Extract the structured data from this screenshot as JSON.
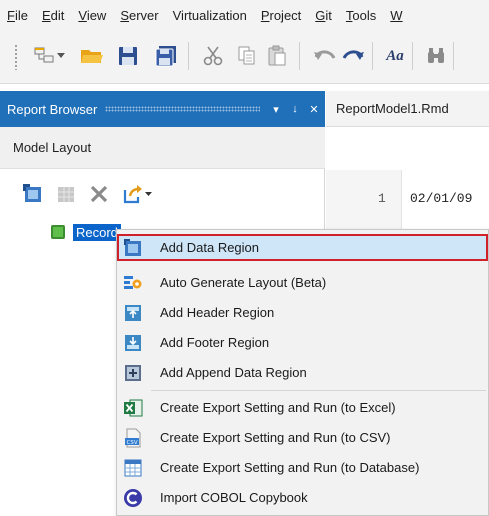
{
  "menubar": {
    "items": [
      {
        "u": "F",
        "rest": "ile"
      },
      {
        "u": "E",
        "rest": "dit"
      },
      {
        "u": "V",
        "rest": "iew"
      },
      {
        "u": "S",
        "rest": "erver"
      },
      {
        "u": "",
        "rest": "Virtualization"
      },
      {
        "u": "P",
        "rest": "roject"
      },
      {
        "u": "G",
        "rest": "it"
      },
      {
        "u": "T",
        "rest": "ools"
      },
      {
        "u": "W",
        "rest": ""
      }
    ]
  },
  "toolbar": {
    "icons": [
      "grip-icon",
      "new-item-icon",
      "open-folder-icon",
      "save-icon",
      "save-all-icon",
      "cut-icon",
      "copy-icon",
      "paste-icon",
      "undo-icon",
      "redo-icon",
      "font-icon",
      "find-icon"
    ],
    "font_label": "Aa"
  },
  "report_browser": {
    "title": "Report Browser",
    "pin_glyph": "↓",
    "close_glyph": "✕",
    "dropdown_glyph": "▾",
    "tab_label": "Model Layout",
    "tree": {
      "record_label": "Record"
    }
  },
  "editor": {
    "tab_label": "ReportModel1.Rmd",
    "line_number": "1",
    "line_text": "02/01/09"
  },
  "context_menu": {
    "items": [
      {
        "label": "Add Data Region",
        "icon": "data-region-icon",
        "highlighted": true
      },
      {
        "label": "Auto Generate Layout (Beta)",
        "icon": "auto-generate-icon"
      },
      {
        "label": "Add Header Region",
        "icon": "header-region-icon"
      },
      {
        "label": "Add Footer Region",
        "icon": "footer-region-icon"
      },
      {
        "label": "Add Append Data Region",
        "icon": "append-region-icon"
      },
      {
        "label": "Create Export Setting and Run (to Excel)",
        "icon": "excel-icon"
      },
      {
        "label": "Create Export Setting and Run (to CSV)",
        "icon": "csv-icon"
      },
      {
        "label": "Create Export Setting and Run (to Database)",
        "icon": "database-table-icon"
      },
      {
        "label": "Import COBOL Copybook",
        "icon": "cobol-icon"
      }
    ]
  },
  "colors": {
    "accent": "#1f6fb9",
    "selection": "#0a64c9",
    "highlight_border": "#d0202a",
    "highlight_fill": "#cfe5f8"
  }
}
